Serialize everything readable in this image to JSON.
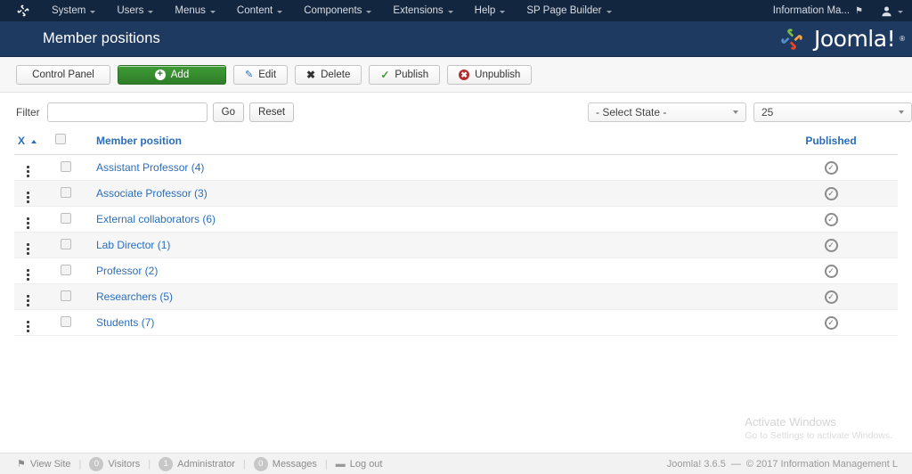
{
  "topbar": {
    "logo_icon": "joomla-mark-icon",
    "menu": [
      {
        "label": "System",
        "has_caret": true
      },
      {
        "label": "Users",
        "has_caret": true
      },
      {
        "label": "Menus",
        "has_caret": true
      },
      {
        "label": "Content",
        "has_caret": true
      },
      {
        "label": "Components",
        "has_caret": true
      },
      {
        "label": "Extensions",
        "has_caret": true
      },
      {
        "label": "Help",
        "has_caret": true
      },
      {
        "label": "SP Page Builder",
        "has_caret": true
      }
    ],
    "site_name": "Information Ma...",
    "site_icon": "external-link-icon",
    "user_icon": "user-icon"
  },
  "header": {
    "page_title": "Member positions",
    "brand_name": "Joomla!",
    "brand_reg": "®"
  },
  "toolbar": {
    "control_panel": "Control Panel",
    "add": "Add",
    "edit": "Edit",
    "delete": "Delete",
    "publish": "Publish",
    "unpublish": "Unpublish"
  },
  "filter": {
    "label": "Filter",
    "value": "",
    "placeholder": "",
    "go": "Go",
    "reset": "Reset",
    "state_select": "- Select State -",
    "limit_select": "25"
  },
  "table": {
    "columns": {
      "ordering": "X",
      "sort_direction": "asc",
      "checkbox": "",
      "name": "Member position",
      "published": "Published"
    },
    "rows": [
      {
        "name": "Assistant Professor (4)",
        "published": true
      },
      {
        "name": "Associate Professor (3)",
        "published": true
      },
      {
        "name": "External collaborators (6)",
        "published": true
      },
      {
        "name": "Lab Director (1)",
        "published": true
      },
      {
        "name": "Professor (2)",
        "published": true
      },
      {
        "name": "Researchers (5)",
        "published": true
      },
      {
        "name": "Students (7)",
        "published": true
      }
    ]
  },
  "watermark": {
    "title": "Activate Windows",
    "subtitle": "Go to Settings to activate Windows."
  },
  "footer": {
    "view_site": "View Site",
    "visitors_count": "0",
    "visitors_label": "Visitors",
    "admin_count": "1",
    "admin_label": "Administrator",
    "messages_count": "0",
    "messages_label": "Messages",
    "logout": "Log out",
    "version": "Joomla! 3.6.5",
    "separator": "—",
    "copyright": "© 2017 Information Management L"
  },
  "colors": {
    "topbar_bg": "#13263f",
    "titlebar_bg": "#1f3a61",
    "link_blue": "#2a6ebb",
    "add_green": "#3f9c35",
    "unpublish_red": "#b32d2d"
  }
}
